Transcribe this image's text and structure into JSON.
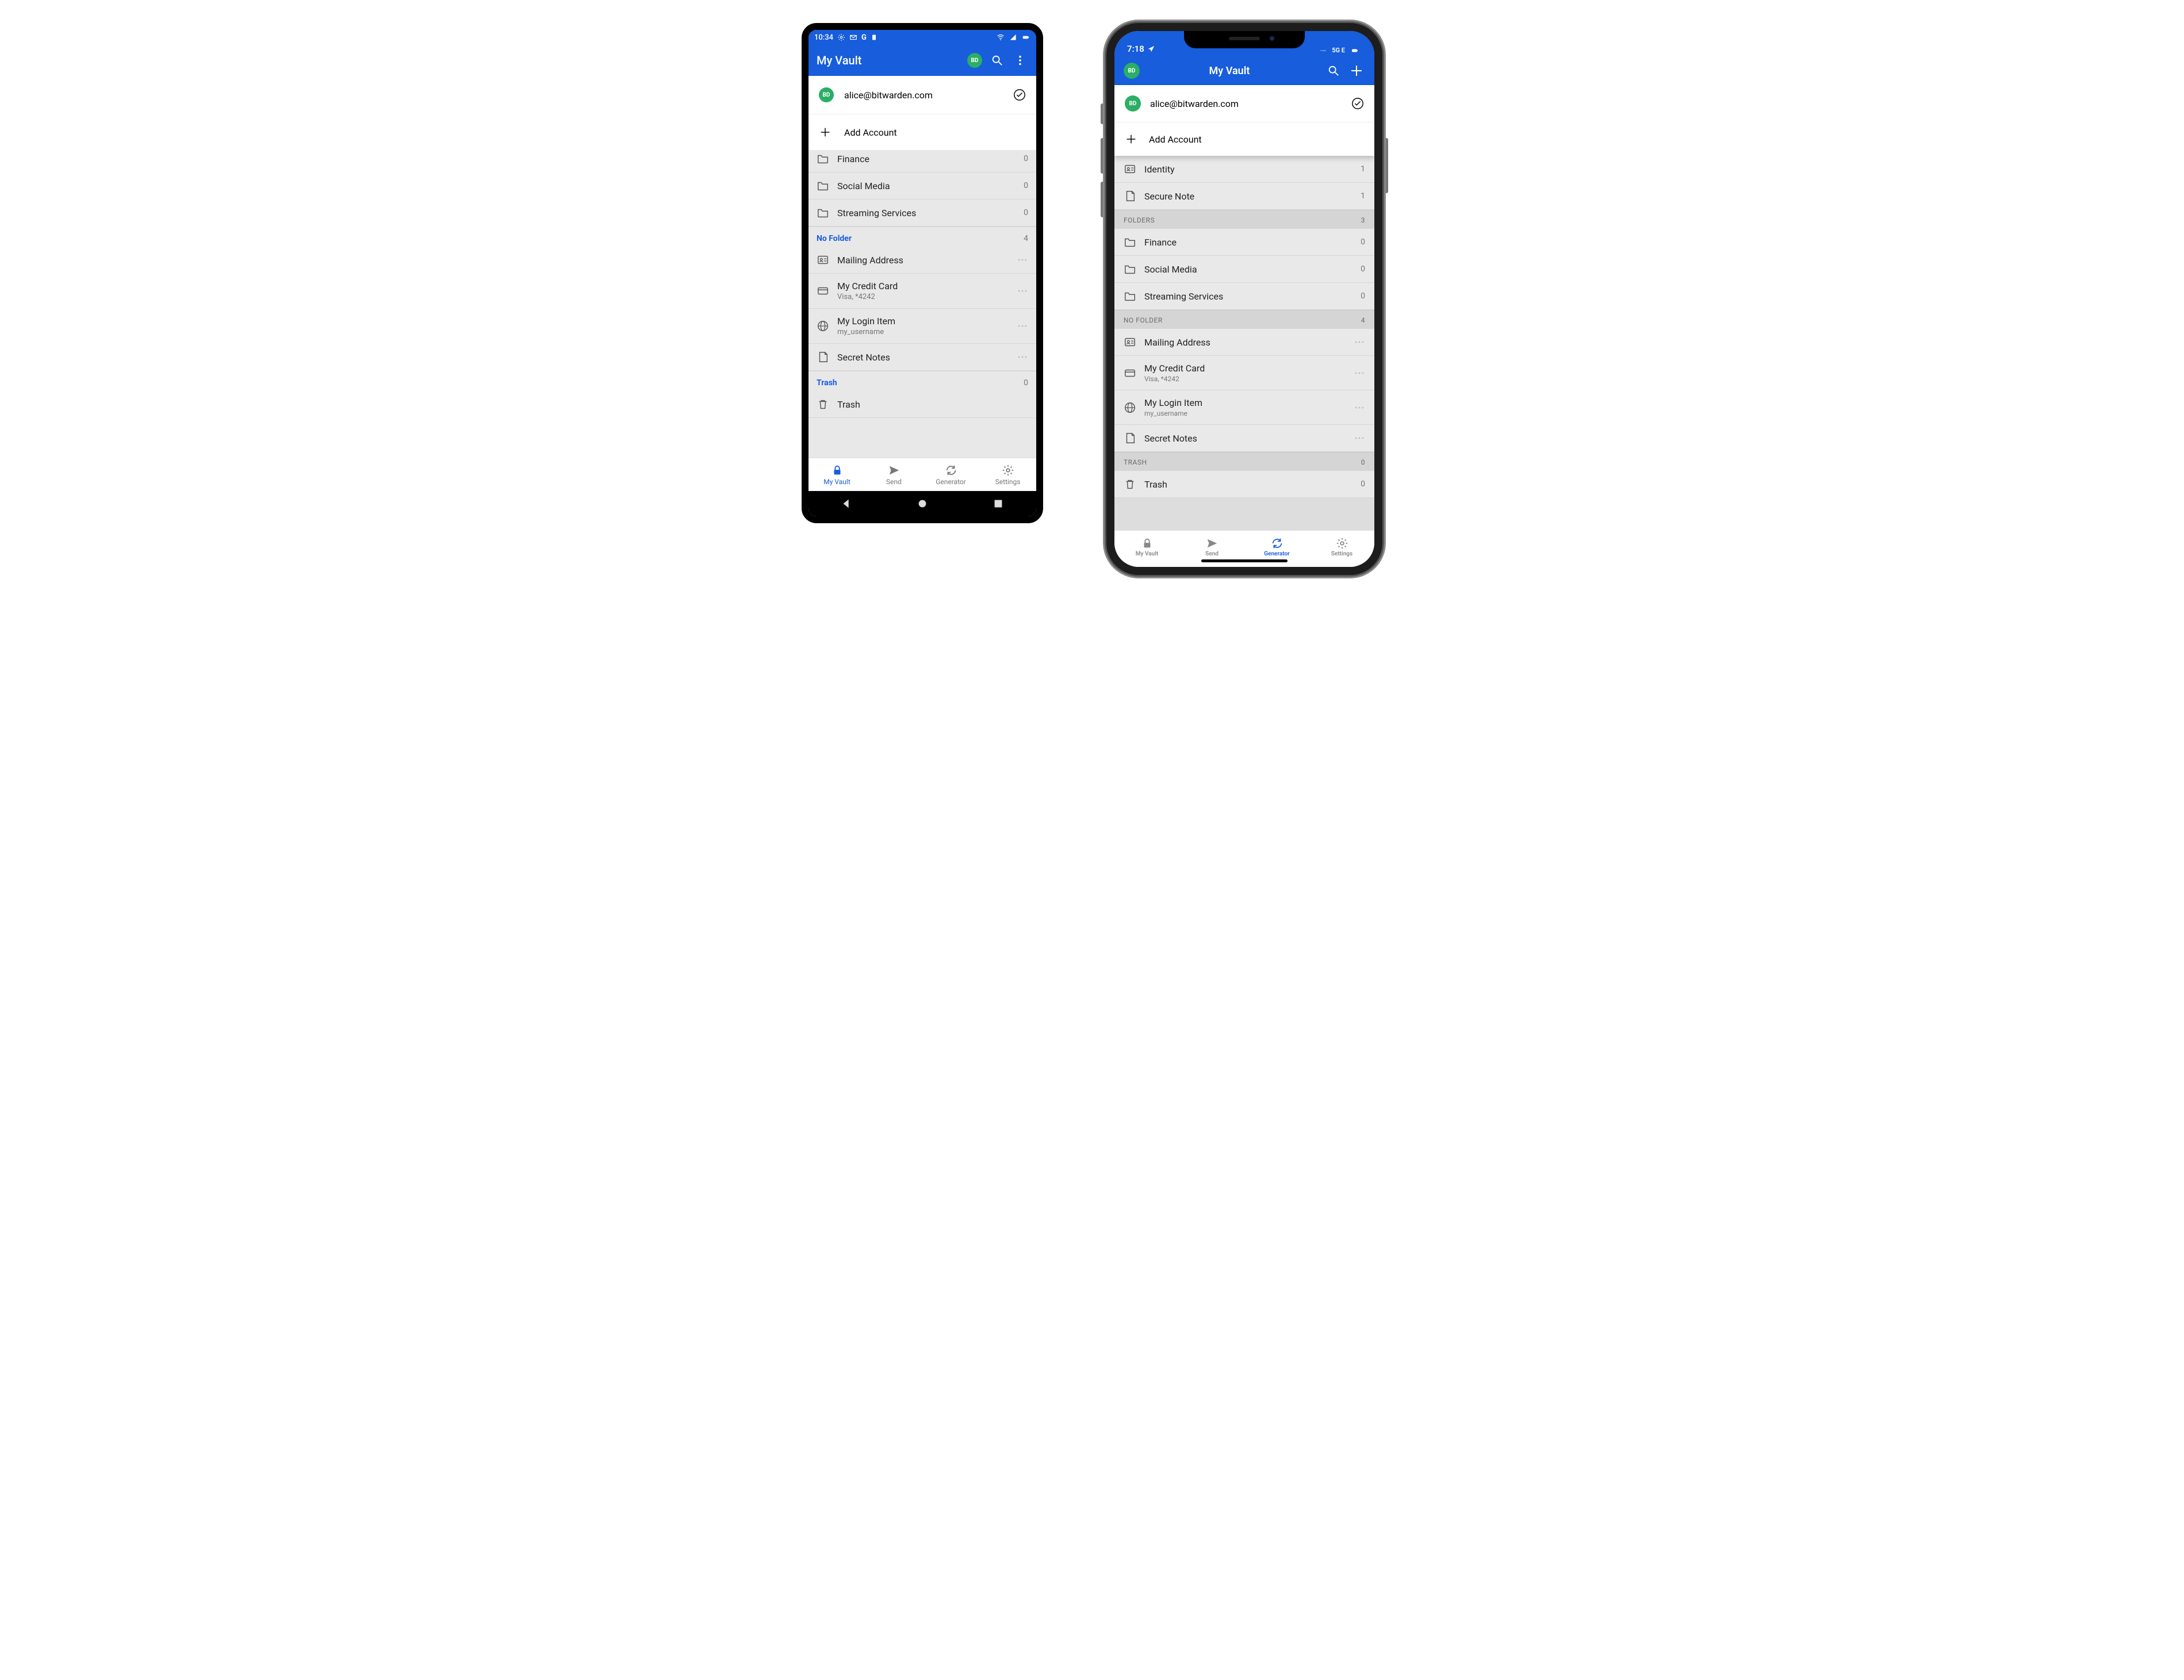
{
  "colors": {
    "accent": "#175ddc",
    "avatar": "#2bae66"
  },
  "android": {
    "statusbar": {
      "time": "10:34",
      "icons_left": [
        "gear",
        "mail",
        "google",
        "card"
      ],
      "icons_right": [
        "wifi",
        "signal",
        "battery"
      ]
    },
    "appbar": {
      "title": "My Vault",
      "avatar_initials": "BD"
    },
    "accounts": {
      "current": {
        "avatar_initials": "BD",
        "email": "alice@bitwarden.com"
      },
      "add_label": "Add Account"
    },
    "list": {
      "partial_top": {
        "name": "Finance",
        "count": 0,
        "icon": "folder"
      },
      "folders": [
        {
          "name": "Social Media",
          "count": 0,
          "icon": "folder"
        },
        {
          "name": "Streaming Services",
          "count": 0,
          "icon": "folder"
        }
      ],
      "section_no_folder": {
        "title": "No Folder",
        "count": 4
      },
      "no_folder_items": [
        {
          "name": "Mailing Address",
          "sub": "",
          "icon": "identity"
        },
        {
          "name": "My Credit Card",
          "sub": "Visa, *4242",
          "icon": "card"
        },
        {
          "name": "My Login Item",
          "sub": "my_username",
          "icon": "globe"
        },
        {
          "name": "Secret Notes",
          "sub": "",
          "icon": "note"
        }
      ],
      "section_trash": {
        "title": "Trash",
        "count": 0
      },
      "trash_item": {
        "name": "Trash",
        "icon": "trash"
      }
    },
    "tabs": [
      {
        "id": "vault",
        "label": "My Vault",
        "active": true
      },
      {
        "id": "send",
        "label": "Send",
        "active": false
      },
      {
        "id": "generator",
        "label": "Generator",
        "active": false
      },
      {
        "id": "settings",
        "label": "Settings",
        "active": false
      }
    ]
  },
  "ios": {
    "statusbar": {
      "time": "7:18",
      "network_label": "5G E"
    },
    "nav": {
      "title": "My Vault",
      "avatar_initials": "BD"
    },
    "accounts": {
      "current": {
        "avatar_initials": "BD",
        "email": "alice@bitwarden.com"
      },
      "add_label": "Add Account"
    },
    "list": {
      "types_partial": [
        {
          "name": "Identity",
          "count": 1,
          "icon": "identity"
        },
        {
          "name": "Secure Note",
          "count": 1,
          "icon": "note"
        }
      ],
      "section_folders": {
        "title": "FOLDERS",
        "count": 3
      },
      "folders": [
        {
          "name": "Finance",
          "count": 0,
          "icon": "folder"
        },
        {
          "name": "Social Media",
          "count": 0,
          "icon": "folder"
        },
        {
          "name": "Streaming Services",
          "count": 0,
          "icon": "folder"
        }
      ],
      "section_no_folder": {
        "title": "NO FOLDER",
        "count": 4
      },
      "no_folder_items": [
        {
          "name": "Mailing Address",
          "sub": "",
          "icon": "identity"
        },
        {
          "name": "My Credit Card",
          "sub": "Visa, *4242",
          "icon": "card"
        },
        {
          "name": "My Login Item",
          "sub": "my_username",
          "icon": "globe"
        },
        {
          "name": "Secret Notes",
          "sub": "",
          "icon": "note"
        }
      ],
      "section_trash": {
        "title": "TRASH",
        "count": 0
      },
      "trash_item": {
        "name": "Trash",
        "icon": "trash"
      }
    },
    "tabs": [
      {
        "id": "vault",
        "label": "My Vault",
        "active": false
      },
      {
        "id": "send",
        "label": "Send",
        "active": false
      },
      {
        "id": "generator",
        "label": "Generator",
        "active": true
      },
      {
        "id": "settings",
        "label": "Settings",
        "active": false
      }
    ]
  }
}
